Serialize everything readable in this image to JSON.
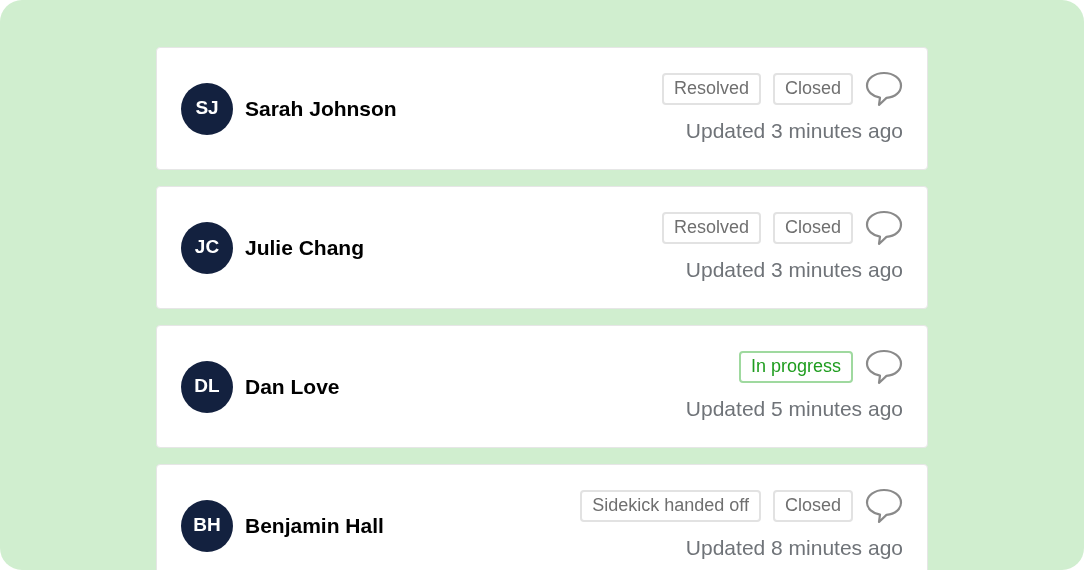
{
  "tickets": [
    {
      "initials": "SJ",
      "name": "Sarah Johnson",
      "tags": [
        {
          "label": "Resolved",
          "kind": "neutral"
        },
        {
          "label": "Closed",
          "kind": "neutral"
        }
      ],
      "updated": "Updated 3 minutes ago"
    },
    {
      "initials": "JC",
      "name": "Julie Chang",
      "tags": [
        {
          "label": "Resolved",
          "kind": "neutral"
        },
        {
          "label": "Closed",
          "kind": "neutral"
        }
      ],
      "updated": "Updated 3 minutes ago"
    },
    {
      "initials": "DL",
      "name": "Dan Love",
      "tags": [
        {
          "label": "In progress",
          "kind": "success"
        }
      ],
      "updated": "Updated 5 minutes ago"
    },
    {
      "initials": "BH",
      "name": "Benjamin Hall",
      "tags": [
        {
          "label": "Sidekick handed off",
          "kind": "neutral"
        },
        {
          "label": "Closed",
          "kind": "neutral"
        }
      ],
      "updated": "Updated 8 minutes ago"
    }
  ]
}
